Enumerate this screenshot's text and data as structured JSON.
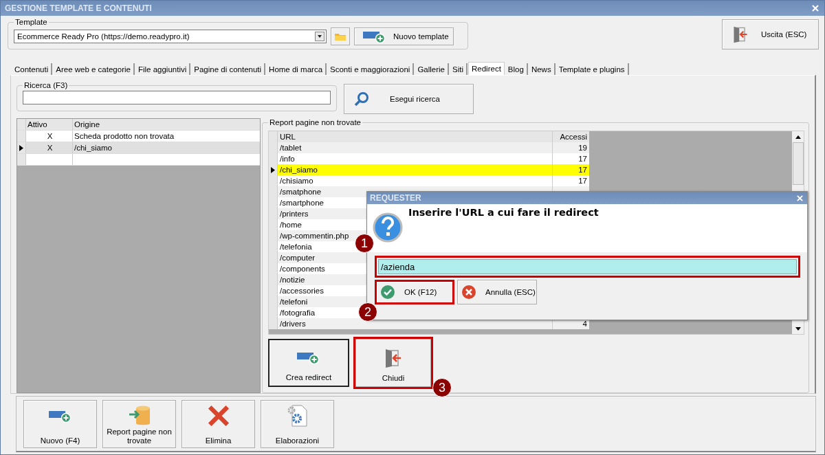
{
  "window": {
    "title": "GESTIONE TEMPLATE E CONTENUTI"
  },
  "template": {
    "label": "Template",
    "value": "Ecommerce Ready Pro (https://demo.readypro.it)",
    "new_button": "Nuovo template"
  },
  "exit_button": "Uscita (ESC)",
  "tabs": [
    {
      "label": "Contenuti",
      "selected": false
    },
    {
      "label": "Aree web e categorie",
      "selected": false
    },
    {
      "label": "File aggiuntivi",
      "selected": false
    },
    {
      "label": "Pagine di contenuti",
      "selected": false
    },
    {
      "label": "Home di marca",
      "selected": false
    },
    {
      "label": "Sconti e maggiorazioni",
      "selected": false
    },
    {
      "label": "Gallerie",
      "selected": false
    },
    {
      "label": "Siti",
      "selected": false
    },
    {
      "label": "Redirect",
      "selected": true
    },
    {
      "label": "Blog",
      "selected": false
    },
    {
      "label": "News",
      "selected": false
    },
    {
      "label": "Template e plugins",
      "selected": false
    }
  ],
  "search": {
    "label": "Ricerca (F3)",
    "button": "Esegui ricerca"
  },
  "redirects": {
    "columns": [
      "Attivo",
      "Origine"
    ],
    "rows": [
      {
        "active": "X",
        "origin": "Scheda prodotto non trovata",
        "selected": false
      },
      {
        "active": "X",
        "origin": "/chi_siamo",
        "selected": true
      }
    ]
  },
  "report": {
    "title": "Report pagine non trovate",
    "columns": [
      "URL",
      "Accessi"
    ],
    "rows": [
      {
        "url": "/tablet",
        "hits": "19",
        "selected": false
      },
      {
        "url": "/info",
        "hits": "17",
        "selected": false
      },
      {
        "url": "/chi_siamo",
        "hits": "17",
        "selected": true
      },
      {
        "url": "/chisiamo",
        "hits": "17",
        "selected": false
      },
      {
        "url": "/smatphone",
        "selected": false
      },
      {
        "url": "/smartphone",
        "selected": false
      },
      {
        "url": "/printers",
        "selected": false
      },
      {
        "url": "/home",
        "selected": false
      },
      {
        "url": "/wp-commentin.php",
        "selected": false
      },
      {
        "url": "/telefonia",
        "selected": false
      },
      {
        "url": "/computer",
        "selected": false
      },
      {
        "url": "/components",
        "selected": false
      },
      {
        "url": "/notizie",
        "selected": false
      },
      {
        "url": "/accessories",
        "selected": false
      },
      {
        "url": "/telefoni",
        "selected": false
      },
      {
        "url": "/fotografia",
        "selected": false
      },
      {
        "url": "/drivers",
        "hits": "4",
        "selected": false
      }
    ],
    "buttons": [
      {
        "label": "Crea redirect",
        "kind": "create",
        "focused": true,
        "highlighted": false
      },
      {
        "label": "Chiudi",
        "kind": "close",
        "focused": false,
        "highlighted": true
      }
    ]
  },
  "toolbar": [
    {
      "label": "Nuovo (F4)",
      "kind": "new"
    },
    {
      "label": "Report pagine non trovate",
      "kind": "report"
    },
    {
      "label": "Elimina",
      "kind": "delete"
    },
    {
      "label": "Elaborazioni",
      "kind": "process"
    }
  ],
  "dialog": {
    "title": "REQUESTER",
    "message": "Inserire l'URL a cui fare il redirect",
    "value": "/azienda",
    "field_highlighted": true,
    "buttons": [
      {
        "label": "OK (F12)",
        "kind": "ok",
        "highlighted": true
      },
      {
        "label": "Annulla (ESC)",
        "kind": "cancel",
        "highlighted": false
      }
    ]
  },
  "callouts": [
    "1",
    "2",
    "3"
  ]
}
